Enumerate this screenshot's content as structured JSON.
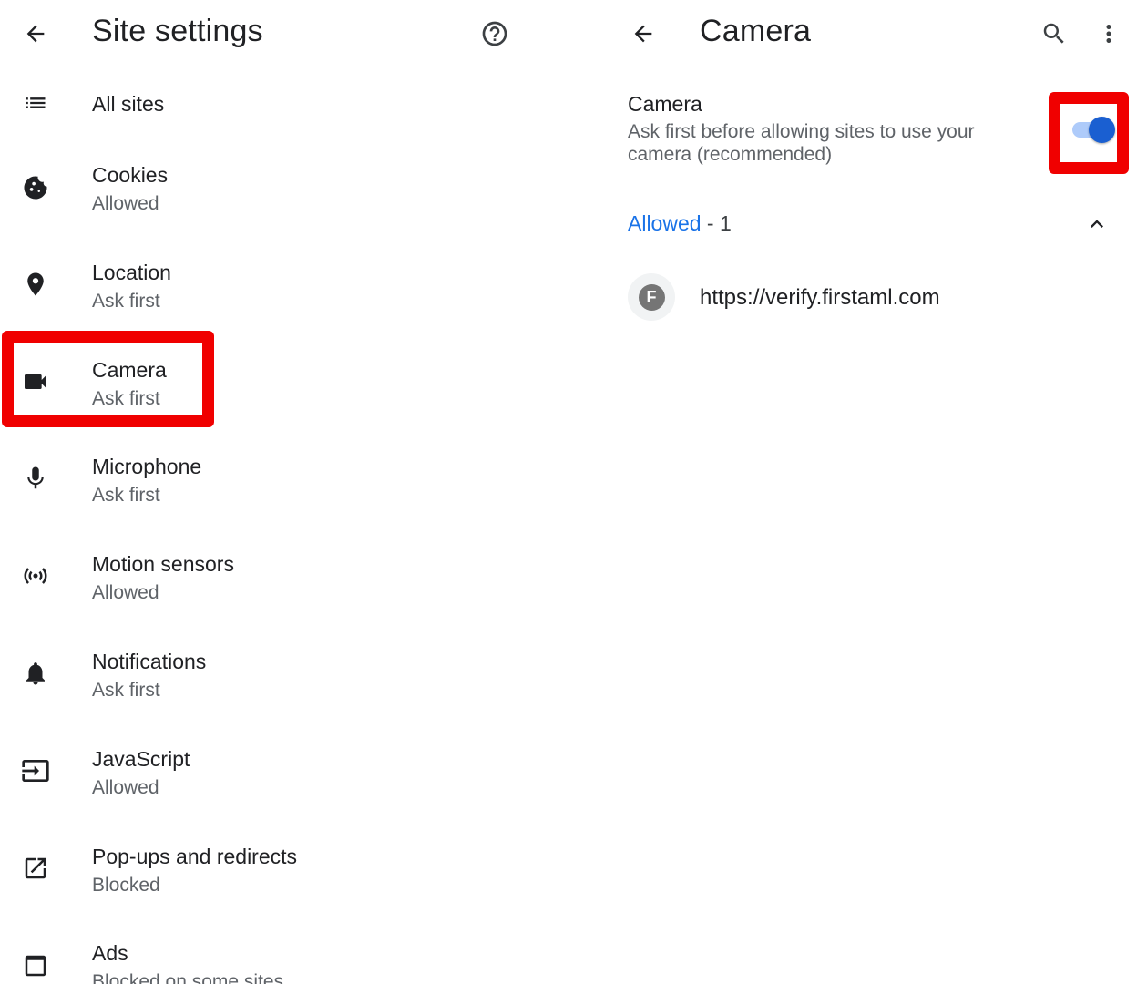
{
  "left": {
    "title": "Site settings",
    "items": [
      {
        "label": "All sites",
        "sub": "",
        "icon": "list-icon"
      },
      {
        "label": "Cookies",
        "sub": "Allowed",
        "icon": "cookie-icon"
      },
      {
        "label": "Location",
        "sub": "Ask first",
        "icon": "location-pin-icon"
      },
      {
        "label": "Camera",
        "sub": "Ask first",
        "icon": "videocam-icon"
      },
      {
        "label": "Microphone",
        "sub": "Ask first",
        "icon": "mic-icon"
      },
      {
        "label": "Motion sensors",
        "sub": "Allowed",
        "icon": "sensors-icon"
      },
      {
        "label": "Notifications",
        "sub": "Ask first",
        "icon": "bell-icon"
      },
      {
        "label": "JavaScript",
        "sub": "Allowed",
        "icon": "input-icon"
      },
      {
        "label": "Pop-ups and redirects",
        "sub": "Blocked",
        "icon": "open-in-new-icon"
      },
      {
        "label": "Ads",
        "sub": "Blocked on some sites",
        "icon": "window-icon"
      }
    ]
  },
  "right": {
    "title": "Camera",
    "setting_title": "Camera",
    "setting_desc": "Ask first before allowing sites to use your camera (recommended)",
    "toggle_on": true,
    "allowed_label": "Allowed",
    "allowed_count": " - 1",
    "site_url": "https://verify.firstaml.com",
    "favicon_letter": "F"
  },
  "colors": {
    "accent": "#1a73e8",
    "highlight": "#f00000",
    "toggle_thumb": "#1a5fd1",
    "toggle_track": "#aecbfa"
  }
}
